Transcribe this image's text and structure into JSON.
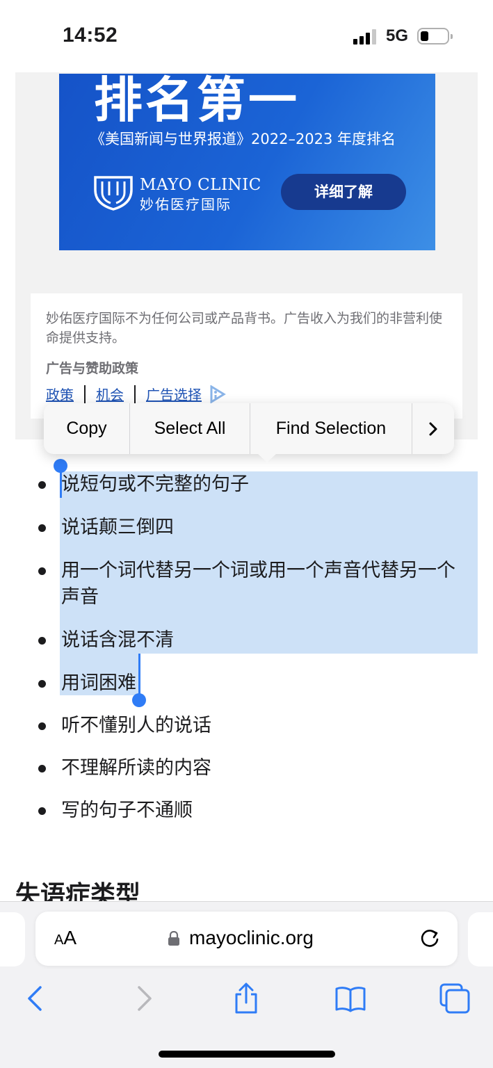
{
  "status_bar": {
    "time": "14:52",
    "network": "5G"
  },
  "ad": {
    "headline": "排名第一",
    "subtitle": "《美国新闻与世界报道》2022–2023 年度排名",
    "logo_en": "MAYO CLINIC",
    "logo_zh": "妙佑医疗国际",
    "cta_label": "详细了解",
    "disclaimer": "妙佑医疗国际不为任何公司或产品背书。广告收入为我们的非营利使命提供支持。",
    "policy_title": "广告与赞助政策",
    "links": [
      "政策",
      "机会",
      "广告选择"
    ]
  },
  "context_menu": {
    "items": [
      "Copy",
      "Select All",
      "Find Selection"
    ]
  },
  "symptoms": [
    "说短句或不完整的句子",
    "说话颠三倒四",
    "用一个词代替另一个词或用一个声音代替另一个声音",
    "说话含混不清",
    "用词困难",
    "听不懂别人的说话",
    "不理解所读的内容",
    "写的句子不通顺"
  ],
  "section_heading": "失语症类型",
  "browser": {
    "text_size_small": "A",
    "text_size_large": "A",
    "url": "mayoclinic.org"
  },
  "icons": {
    "back": "chevron-left-icon",
    "forward": "chevron-right-icon",
    "share": "share-icon",
    "bookmarks": "book-icon",
    "tabs": "tabs-icon"
  },
  "colors": {
    "link": "#1f53b4",
    "selection": "#cde1f7",
    "handle": "#2f7cf6",
    "toolbar_icon": "#2f7cf6"
  }
}
